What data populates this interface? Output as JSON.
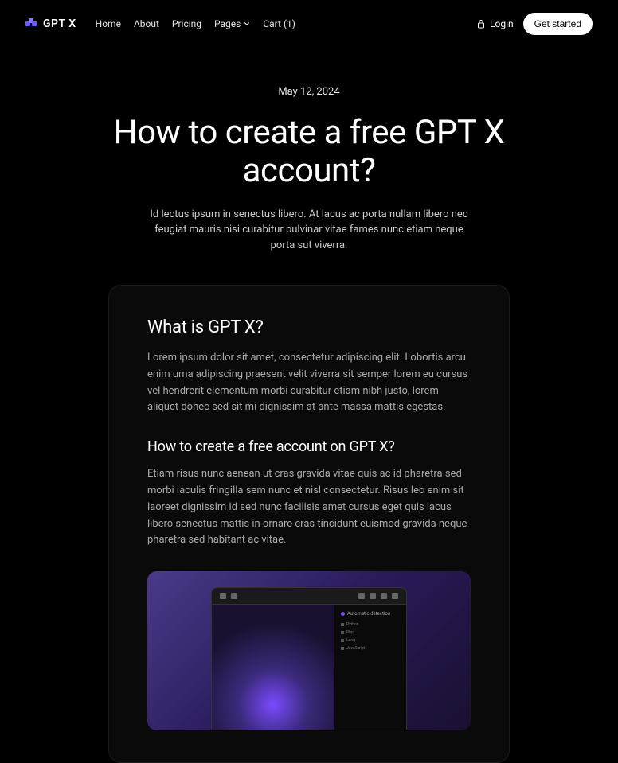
{
  "nav": {
    "logo": "GPT X",
    "links": {
      "home": "Home",
      "about": "About",
      "pricing": "Pricing",
      "pages": "Pages",
      "cart": "Cart (1)"
    },
    "login": "Login",
    "getStarted": "Get started"
  },
  "hero": {
    "date": "May 12, 2024",
    "title": "How to create a free GPT X account?",
    "subtitle": "Id lectus ipsum in senectus libero. At lacus ac porta nullam libero nec feugiat mauris nisi curabitur pulvinar vitae fames nunc etiam neque porta sut viverra."
  },
  "content": {
    "section1": {
      "title": "What is GPT X?",
      "body": "Lorem ipsum dolor sit amet, consectetur adipiscing elit. Lobortis arcu enim urna adipiscing praesent velit viverra sit semper lorem eu cursus vel hendrerit elementum morbi curabitur etiam nibh justo, lorem aliquet donec sed sit mi dignissim at ante massa mattis egestas."
    },
    "section2": {
      "title": "How to create a free account on GPT X?",
      "body": "Etiam risus nunc aenean ut cras gravida vitae quis ac id pharetra sed morbi iaculis fringilla sem nunc et nisl consectetur. Risus leo enim sit laoreet dignissim id sed nunc facilisis amet cursus eget quis lacus libero senectus mattis in ornare cras tincidunt euismod gravida neque pharetra sed habitant ac vitae."
    },
    "mockSidebar": {
      "title": "Automatic detection",
      "items": [
        "Python",
        "Php",
        "Lang",
        "JavaScript"
      ]
    }
  }
}
